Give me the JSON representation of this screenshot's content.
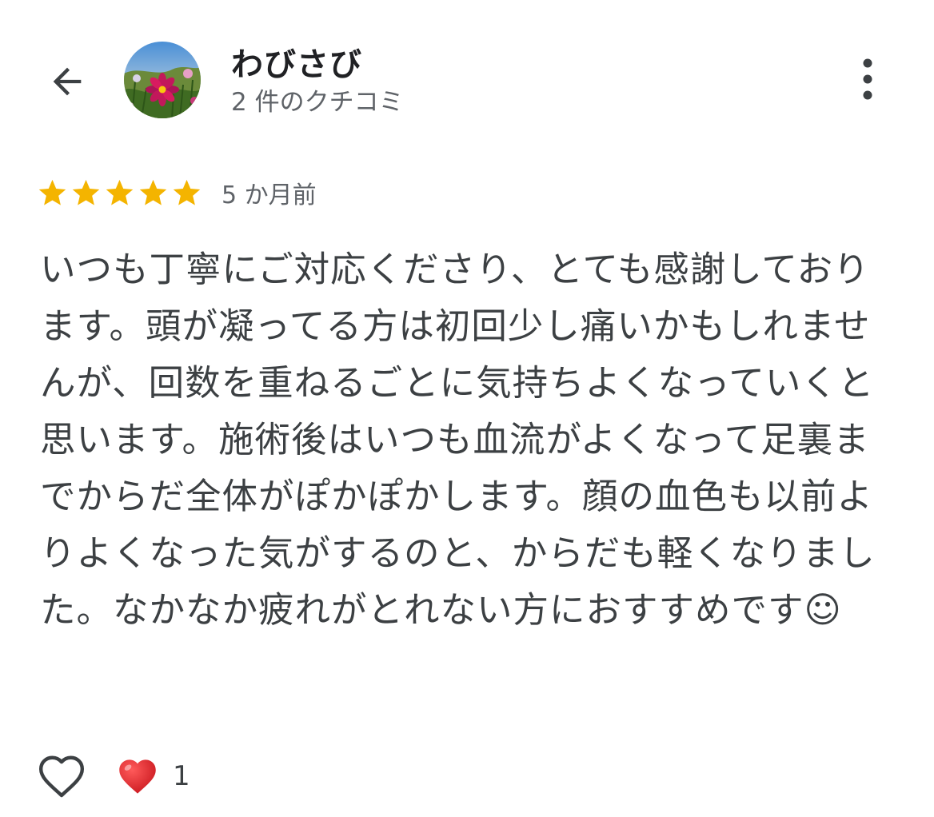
{
  "header": {
    "back_icon": "arrow-left-icon",
    "avatar_icon": "cosmos-flower-photo",
    "user_name": "わびさび",
    "review_count": "2 件のクチコミ",
    "more_icon": "more-vertical-icon"
  },
  "review": {
    "rating": 5,
    "max_rating": 5,
    "star_color": "#f4b400",
    "time_ago": "5 か月前",
    "text": "いつも丁寧にご対応くださり、とても感謝しております。頭が凝ってる方は初回少し痛いかもしれませんが、回数を重ねるごとに気持ちよくなっていくと思います。施術後はいつも血流がよくなって足裏までからだ全体がぽかぽかします。顔の血色も以前よりよくなった気がするのと、からだも軽くなりました。なかなか疲れがとれない方におすすめです☺︎"
  },
  "footer": {
    "like_icon": "heart-outline-icon",
    "reaction_icon": "red-heart-icon",
    "reaction_count": "1"
  }
}
